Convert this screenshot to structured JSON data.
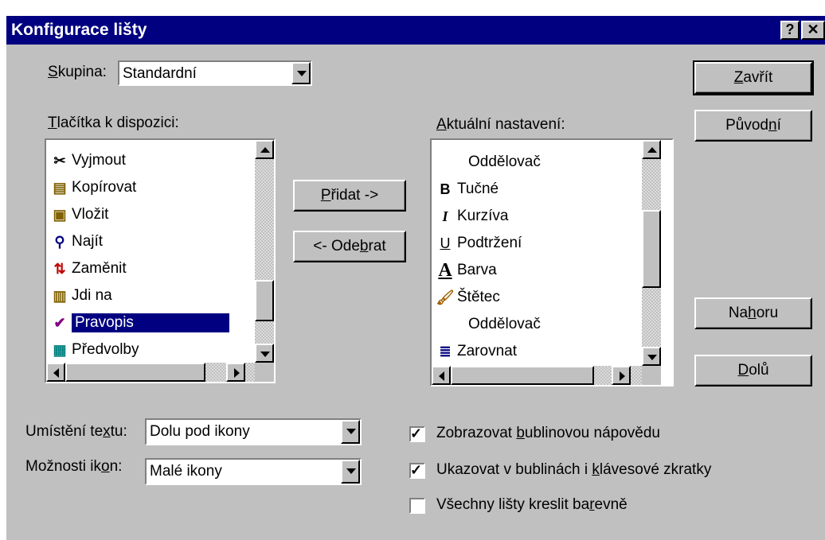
{
  "window": {
    "title": "Konfigurace lišty",
    "help_label": "?",
    "close_label": "✕"
  },
  "group": {
    "label_pre": "",
    "label_u": "S",
    "label_post": "kupina:",
    "value": "Standardní"
  },
  "available": {
    "label_pre": "",
    "label_u": "T",
    "label_post": "lačítka k dispozici:",
    "items": [
      {
        "label": "Vyjmout",
        "icon": "scissors-icon"
      },
      {
        "label": "Kopírovat",
        "icon": "copy-icon"
      },
      {
        "label": "Vložit",
        "icon": "paste-icon"
      },
      {
        "label": "Najít",
        "icon": "find-icon"
      },
      {
        "label": "Zaměnit",
        "icon": "replace-icon"
      },
      {
        "label": "Jdi na",
        "icon": "goto-icon"
      },
      {
        "label": "Pravopis",
        "icon": "spelling-icon",
        "selected": true
      },
      {
        "label": "Předvolby",
        "icon": "preferences-icon"
      }
    ]
  },
  "current": {
    "label_pre": "",
    "label_u": "A",
    "label_post": "ktuální nastavení:",
    "items": [
      {
        "label": "Oddělovač",
        "icon": ""
      },
      {
        "label": "Tučné",
        "icon": "bold-icon"
      },
      {
        "label": "Kurzíva",
        "icon": "italic-icon"
      },
      {
        "label": "Podtržení",
        "icon": "underline-icon"
      },
      {
        "label": "Barva",
        "icon": "font-color-icon"
      },
      {
        "label": "Štětec",
        "icon": "brush-icon"
      },
      {
        "label": "Oddělovač",
        "icon": ""
      },
      {
        "label": "Zarovnat",
        "icon": "align-icon"
      }
    ]
  },
  "buttons": {
    "add": {
      "pre": "",
      "u": "P",
      "post": "řidat ->"
    },
    "remove": {
      "pre": "<- Ode",
      "u": "b",
      "post": "rat"
    },
    "close": {
      "pre": "",
      "u": "Z",
      "post": "avřít"
    },
    "original": {
      "pre": "Původ",
      "u": "n",
      "post": "í"
    },
    "up": {
      "pre": "Na",
      "u": "h",
      "post": "oru"
    },
    "down": {
      "pre": "",
      "u": "D",
      "post": "olů"
    }
  },
  "text_placement": {
    "label_pre": "Umístění te",
    "label_u": "x",
    "label_post": "tu:",
    "value": "Dolu pod ikony"
  },
  "icon_options": {
    "label_pre": "Možnosti ik",
    "label_u": "o",
    "label_post": "n:",
    "value": "Malé ikony"
  },
  "checkboxes": [
    {
      "pre": "Zobrazovat ",
      "u": "b",
      "post": "ublinovou nápovědu",
      "checked": true
    },
    {
      "pre": "Ukazovat v bublinách i ",
      "u": "k",
      "post": "lávesové zkratky",
      "checked": true
    },
    {
      "pre": "Všechny lišty kreslit ba",
      "u": "r",
      "post": "evně",
      "checked": false
    }
  ]
}
